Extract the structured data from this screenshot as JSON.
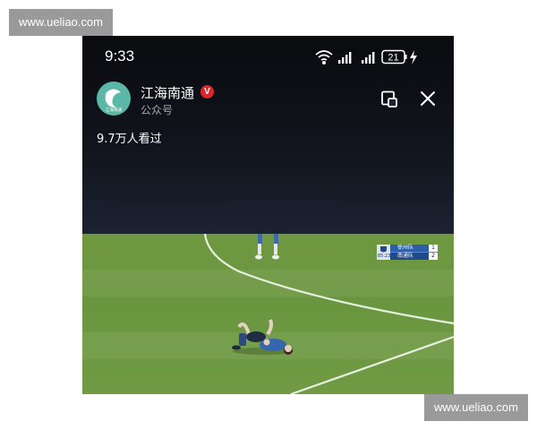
{
  "watermarks": {
    "top": "www.ueliao.com",
    "bottom": "www.ueliao.com"
  },
  "status_bar": {
    "time": "9:33",
    "battery": "21",
    "icons": [
      "wifi-icon",
      "signal-icon",
      "signal-icon",
      "battery-icon",
      "charging-icon"
    ]
  },
  "account": {
    "name": "江海南通",
    "verified_badge": "V",
    "type": "公众号",
    "avatar_text": "江海南通"
  },
  "video": {
    "view_count": "9.7万人看过"
  },
  "controls": {
    "icons": [
      "picture-in-picture-icon",
      "close-icon"
    ]
  },
  "scoreboard": {
    "clock": "85:23",
    "teams": [
      {
        "name": "徐州队",
        "score": "1"
      },
      {
        "name": "南通队",
        "score": "2"
      }
    ]
  },
  "colors": {
    "pitch": "#6f9840",
    "header_bg": "#0a0b0f",
    "verified": "#e0232a",
    "avatar": "#5bb7a7"
  }
}
